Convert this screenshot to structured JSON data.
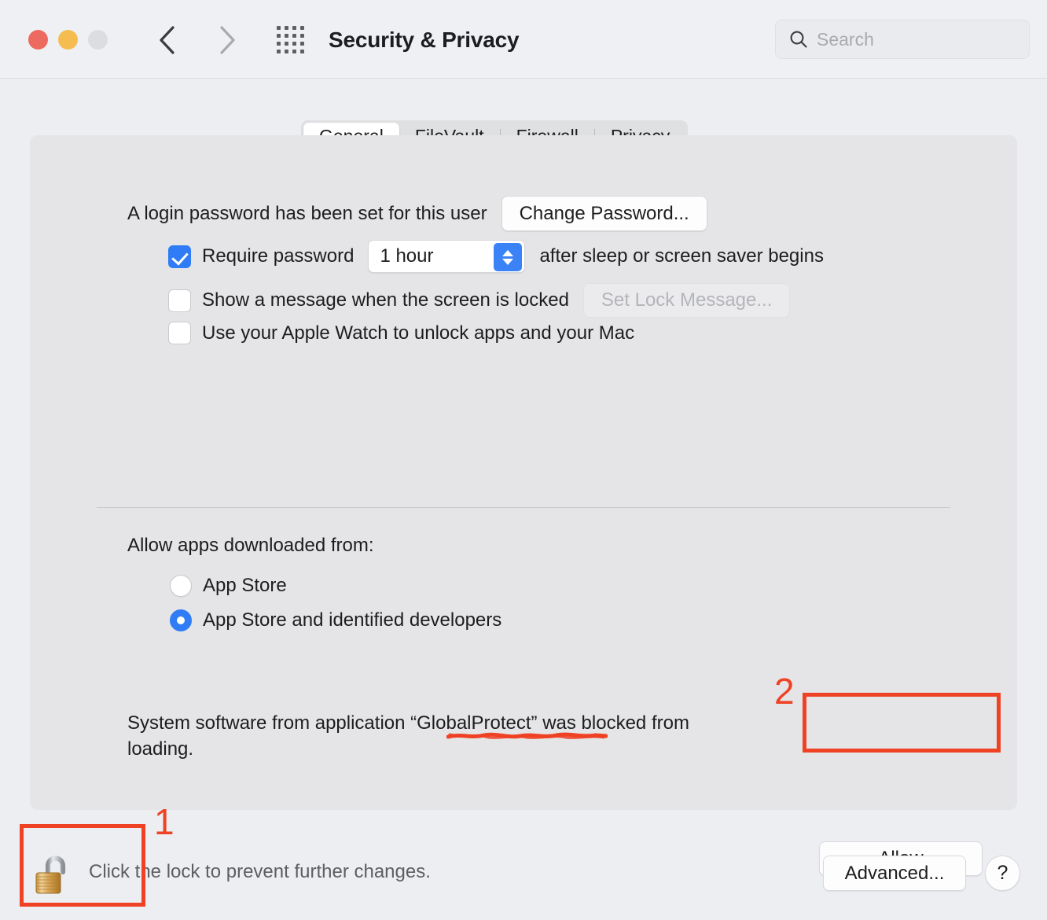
{
  "window": {
    "title": "Security & Privacy",
    "traffic_lights": [
      "close",
      "minimize",
      "zoom"
    ],
    "back_icon": "chevron-left-icon",
    "forward_icon": "chevron-right-icon",
    "grid_icon": "show-all-preferences-icon",
    "colors": {
      "close": "#ec6a5f",
      "minimize": "#f5bd4f",
      "zoom": "#dcdde0",
      "accent": "#2f7cf6",
      "annotation": "#ef4123"
    }
  },
  "search": {
    "placeholder": "Search",
    "value": "",
    "icon": "search-icon"
  },
  "tabs": [
    {
      "label": "General",
      "active": true
    },
    {
      "label": "FileVault",
      "active": false
    },
    {
      "label": "Firewall",
      "active": false
    },
    {
      "label": "Privacy",
      "active": false
    }
  ],
  "general": {
    "password_status": "A login password has been set for this user",
    "change_password_button": "Change Password...",
    "require_password": {
      "checked": true,
      "label": "Require password",
      "delay_value": "1 hour",
      "suffix": "after sleep or screen saver begins"
    },
    "show_message": {
      "checked": false,
      "label": "Show a message when the screen is locked",
      "button": "Set Lock Message...",
      "button_disabled": true
    },
    "apple_watch": {
      "checked": false,
      "label": "Use your Apple Watch to unlock apps and your Mac"
    },
    "allow_apps_heading": "Allow apps downloaded from:",
    "allow_apps_options": [
      {
        "label": "App Store",
        "selected": false
      },
      {
        "label": "App Store and identified developers",
        "selected": true
      }
    ],
    "blocked_notice": "System software from application “GlobalProtect” was blocked from loading.",
    "blocked_app_name": "GlobalProtect",
    "allow_button": "Allow"
  },
  "footer": {
    "lock_icon": "unlocked-padlock-icon",
    "lock_text": "Click the lock to prevent further changes.",
    "advanced_button": "Advanced...",
    "help_button": "?"
  },
  "annotations": [
    {
      "number": "1",
      "target": "lock-icon"
    },
    {
      "number": "2",
      "target": "allow-button"
    }
  ]
}
